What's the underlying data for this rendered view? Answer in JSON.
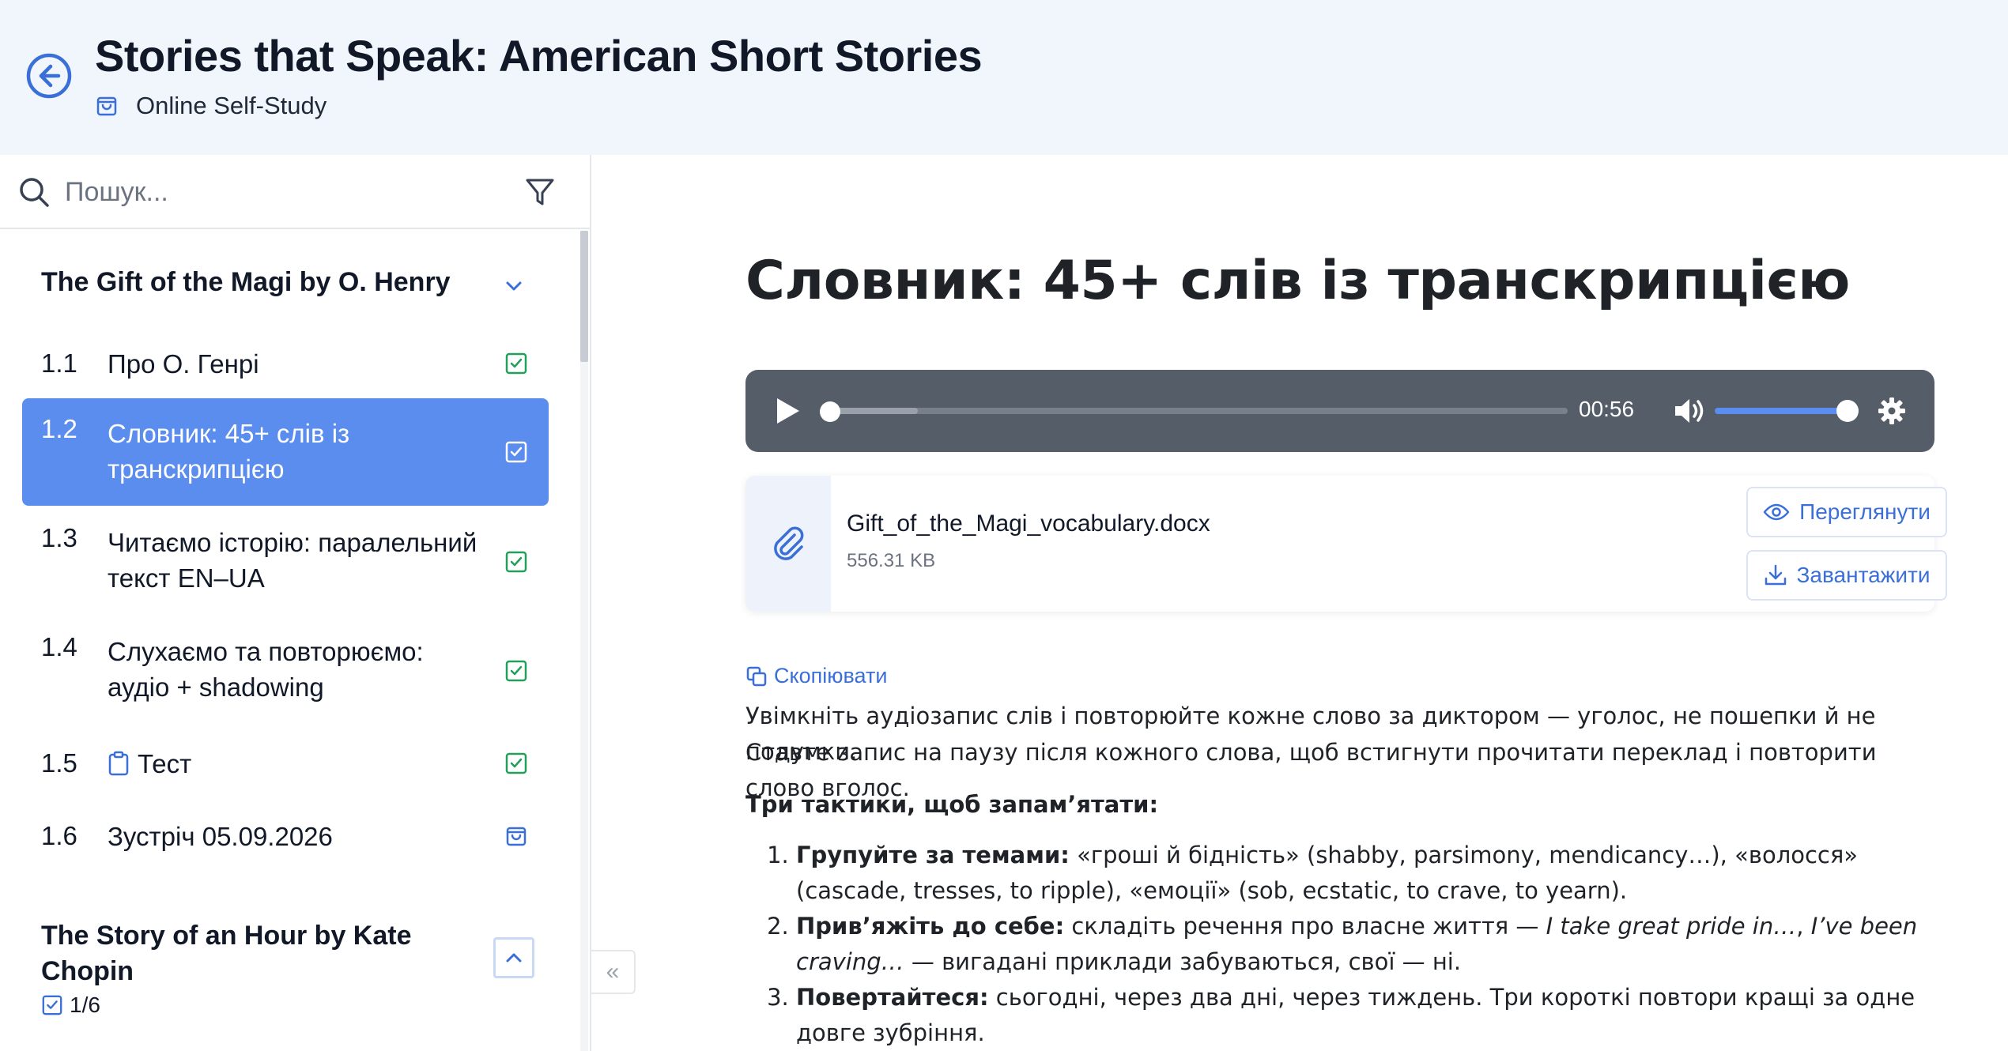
{
  "header": {
    "title": "Stories that Speak: American Short Stories",
    "subtitle": "Online Self-Study"
  },
  "sidebar": {
    "search_placeholder": "Пошук...",
    "sections": [
      {
        "title": "The Gift of the Magi by O. Henry",
        "expanded": true,
        "lessons": [
          {
            "num": "1.1",
            "label": "Про О. Генрі",
            "status": "completed"
          },
          {
            "num": "1.2",
            "label": "Словник: 45+ слів із транскрипцією",
            "status": "completed",
            "active": true
          },
          {
            "num": "1.3",
            "label": "Читаємо історію: паралельний текст EN–UA",
            "status": "completed"
          },
          {
            "num": "1.4",
            "label": "Слухаємо та повторюємо: аудіо + shadowing",
            "status": "completed"
          },
          {
            "num": "1.5",
            "label": "Тест",
            "status": "completed",
            "type": "quiz"
          },
          {
            "num": "1.6",
            "label": "Зустріч 05.09.2026",
            "status": "meeting"
          }
        ]
      },
      {
        "title": "The Story of an Hour by Kate Chopin",
        "expanded": false,
        "progress": "1/6"
      }
    ],
    "collapse_label": "«"
  },
  "main": {
    "lesson_title": "Словник: 45+ слів із транскрипцією",
    "audio": {
      "time": "00:56",
      "progress": 0.0,
      "volume": 1.0
    },
    "attachment": {
      "file_name": "Gift_of_the_Magi_vocabulary.docx",
      "file_size": "556.31 KB",
      "view_label": "Переглянути",
      "download_label": "Завантажити"
    },
    "copy_label": "Скопіювати",
    "intro_line1": "Увімкніть аудіозапис слів і повторюйте кожне слово за диктором — уголос, не пошепки й не подумки.",
    "intro_line2": "Ставте запис на паузу після кожного слова, щоб встигнути прочитати переклад і повторити слово вголос.",
    "tactics_heading": "Три тактики, щоб запам’ятати:",
    "tactics": [
      {
        "bold": "Групуйте за темами:",
        "text": " «гроші й бідність» (shabby, parsimony, mendicancy…), «волосся» (cascade, tresses, to ripple), «емоції» (sob, ecstatic, to crave, to yearn)."
      },
      {
        "bold": "Прив’яжіть до себе:",
        "text_before": " складіть речення про власне життя — ",
        "italic1": "I take great pride in…",
        "text_mid": ", ",
        "italic2": "I’ve been craving…",
        "text_after": " — вигадані приклади забуваються, свої — ні."
      },
      {
        "bold": "Повертайтеся:",
        "text": " сьогодні, через два дні, через тиждень. Три короткі повтори кращі за одне довге зубріння."
      }
    ]
  },
  "colors": {
    "accent": "#5b8def",
    "link": "#3b6fd8",
    "success": "#22a05a",
    "header_bg": "#f1f5fc",
    "player_bg": "#545d68"
  }
}
